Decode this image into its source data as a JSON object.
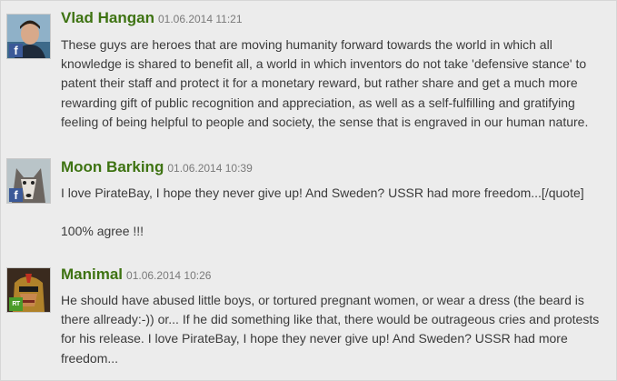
{
  "comments": [
    {
      "author": "Vlad Hangan",
      "date": "01.06.2014 11:21",
      "badge": "facebook-icon",
      "paragraphs": [
        "These guys are heroes that are moving humanity forward towards the world in which all knowledge is shared to benefit all, a world in which inventors do not take 'defensive stance' to patent their staff and protect it for a monetary reward, but rather share and get a much more rewarding gift of public recognition and appreciation, as well as a self-fulfilling and gratifying feeling of being helpful to people and society, the sense that is engraved in our human nature."
      ]
    },
    {
      "author": "Moon Barking",
      "date": "01.06.2014 10:39",
      "badge": "facebook-icon",
      "paragraphs": [
        "I love PirateBay, I hope they never give up! And Sweden? USSR had more freedom...[/quote]",
        "100% agree !!!"
      ]
    },
    {
      "author": "Manimal",
      "date": "01.06.2014 10:26",
      "badge": "rt-icon",
      "badge_text": "RT",
      "paragraphs": [
        "He should have abused little boys, or tortured pregnant women, or wear a dress (the beard is there allready:-)) or... If he did something like that, there would be outrageous cries and protests for his release. I love PirateBay, I hope they never give up! And Sweden? USSR had more freedom..."
      ]
    }
  ],
  "colors": {
    "author": "#3e7312",
    "date": "#7a7a7a",
    "text": "#3a3a3a",
    "background": "#ececec",
    "facebook": "#3b5998"
  }
}
